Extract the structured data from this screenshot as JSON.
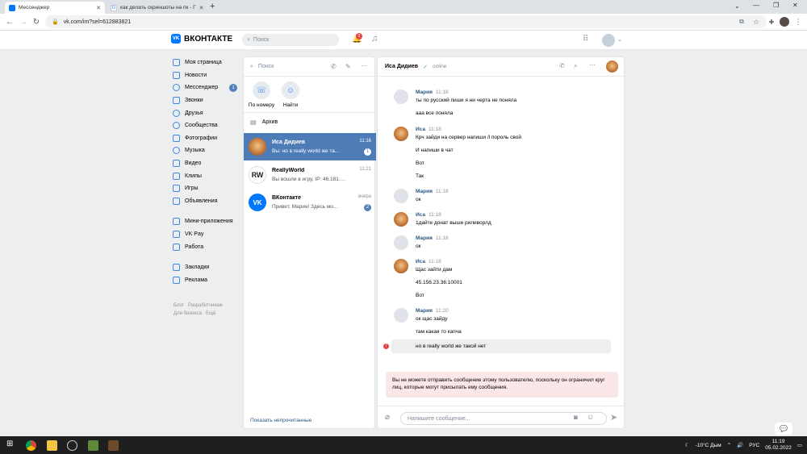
{
  "browser": {
    "tabs": [
      {
        "title": "Мессенджер",
        "active": true
      },
      {
        "title": "как делать скриншоты на пк - Г",
        "active": false
      }
    ],
    "new_tab": "+",
    "url": "vk.com/im?sel=612883821"
  },
  "header": {
    "logo_text": "ВКОНТАКТЕ",
    "search_placeholder": "Поиск",
    "notifications_count": "2"
  },
  "menu": {
    "main": [
      {
        "label": "Моя страница",
        "icon": "user-icon"
      },
      {
        "label": "Новости",
        "icon": "news-icon"
      },
      {
        "label": "Мессенджер",
        "icon": "message-icon",
        "badge": "1"
      },
      {
        "label": "Звонки",
        "icon": "phone-icon"
      },
      {
        "label": "Друзья",
        "icon": "friends-icon"
      },
      {
        "label": "Сообщества",
        "icon": "groups-icon"
      },
      {
        "label": "Фотографии",
        "icon": "photo-icon"
      },
      {
        "label": "Музыка",
        "icon": "music-icon"
      },
      {
        "label": "Видео",
        "icon": "video-icon"
      },
      {
        "label": "Клипы",
        "icon": "clips-icon"
      },
      {
        "label": "Игры",
        "icon": "games-icon"
      },
      {
        "label": "Объявления",
        "icon": "ads-icon"
      }
    ],
    "secondary": [
      {
        "label": "Мини-приложения",
        "icon": "apps-icon"
      },
      {
        "label": "VK Pay",
        "icon": "pay-icon"
      },
      {
        "label": "Работа",
        "icon": "work-icon"
      }
    ],
    "tertiary": [
      {
        "label": "Закладки",
        "icon": "bookmark-icon"
      },
      {
        "label": "Реклама",
        "icon": "megaphone-icon"
      }
    ],
    "footer_links": [
      "Блог",
      "Разработчикам",
      "Для бизнеса",
      "Ещё"
    ]
  },
  "chatlist": {
    "search_placeholder": "Поиск",
    "quick_actions": [
      {
        "label": "По номеру",
        "icon": "phone-plus-icon"
      },
      {
        "label": "Найти",
        "icon": "person-search-icon"
      }
    ],
    "archive_label": "Архив",
    "conversations": [
      {
        "name": "Иса Дидиев",
        "preview": "Вы: но в really world же та...",
        "time": "11:16",
        "badge": "1",
        "selected": true
      },
      {
        "name": "ReallyWorld",
        "preview": "Вы вошли в игру, IP: 46.181.21...",
        "time": "11:21",
        "badge": "",
        "selected": false
      },
      {
        "name": "ВКонтакте",
        "preview": "Привет, Мария! Здесь мо...",
        "time": "вчера",
        "badge": "2",
        "selected": false
      }
    ],
    "show_unread": "Показать непрочитанные"
  },
  "chat": {
    "name": "Иса Дидиев",
    "status": "online",
    "messages": [
      {
        "author": "Мария",
        "time": "11:18",
        "lines": [
          "ты по русский пиши я ни черта не поняла",
          "ааа все поняла"
        ],
        "avatar": "gray"
      },
      {
        "author": "Иса",
        "time": "11:18",
        "lines": [
          "Крч зайди на сервер напиши /l пороль свой",
          "И напиши в чат",
          "Вот",
          "Так"
        ],
        "avatar": "dog"
      },
      {
        "author": "Мария",
        "time": "11:18",
        "lines": [
          "ок"
        ],
        "avatar": "gray"
      },
      {
        "author": "Иса",
        "time": "11:18",
        "lines": [
          "1дайте донат выше риливорлд"
        ],
        "avatar": "dog"
      },
      {
        "author": "Мария",
        "time": "11:18",
        "lines": [
          "ок"
        ],
        "avatar": "gray"
      },
      {
        "author": "Иса",
        "time": "11:18",
        "lines": [
          "Щас зайти дам",
          "45.156.23.36:10001",
          "Вот"
        ],
        "avatar": "dog"
      },
      {
        "author": "Мария",
        "time": "11:20",
        "lines": [
          "ок щас зайду",
          "там какая то капча"
        ],
        "avatar": "gray"
      }
    ],
    "failed_message": "но в really world же такой нет",
    "warning": "Вы не можете отправить сообщение этому пользователю, поскольку он ограничил круг лиц, которые могут присылать ему сообщения.",
    "input_placeholder": "Напишите сообщение..."
  },
  "taskbar": {
    "weather": "-10°C Дым",
    "lang": "РУС",
    "time": "11:19",
    "date": "05.02.2022"
  }
}
